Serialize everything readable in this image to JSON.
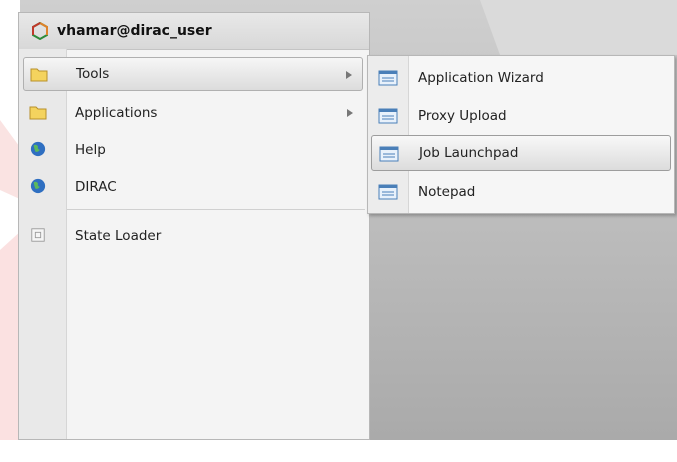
{
  "user": {
    "name": "vhamar@dirac_user",
    "icon": "hexagon-logo-icon"
  },
  "menu": {
    "items": [
      {
        "label": "Tools",
        "icon": "folder-icon",
        "has_submenu": true
      },
      {
        "label": "Applications",
        "icon": "folder-icon",
        "has_submenu": true
      },
      {
        "label": "Help",
        "icon": "globe-icon",
        "has_submenu": false
      },
      {
        "label": "DIRAC",
        "icon": "globe-icon",
        "has_submenu": false
      },
      {
        "label": "State Loader",
        "icon": "square-icon",
        "has_submenu": false
      }
    ]
  },
  "submenu": {
    "items": [
      {
        "label": "Application Wizard",
        "icon": "app-window-icon"
      },
      {
        "label": "Proxy Upload",
        "icon": "app-window-icon"
      },
      {
        "label": "Job Launchpad",
        "icon": "app-window-icon"
      },
      {
        "label": "Notepad",
        "icon": "app-window-icon"
      }
    ]
  },
  "colors": {
    "accent_red": "#e53935",
    "desktop": "#b8b8b8"
  }
}
